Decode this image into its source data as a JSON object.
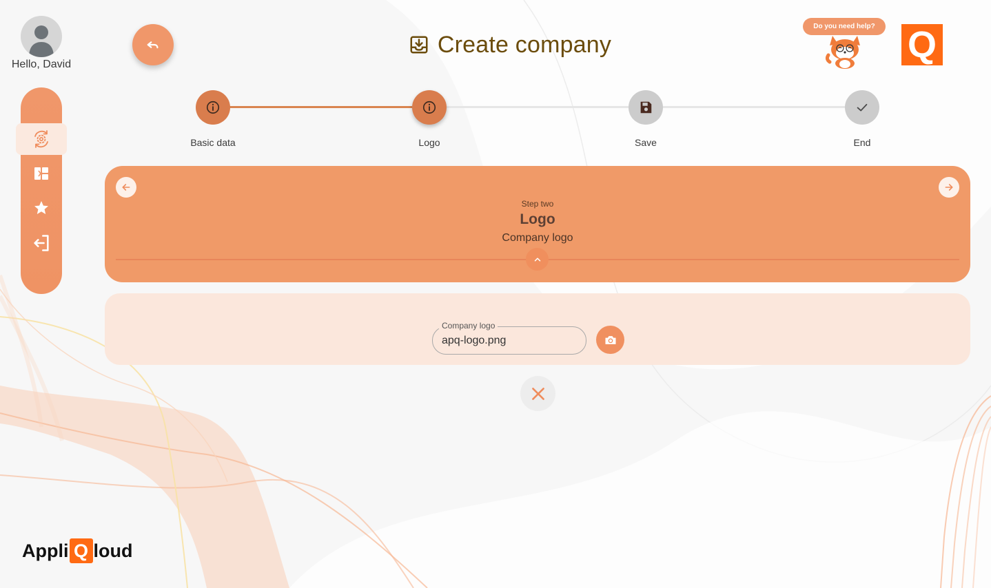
{
  "user": {
    "greeting": "Hello, David"
  },
  "header": {
    "title": "Create company",
    "title_icon": "download-box-icon",
    "help_text": "Do you need help?"
  },
  "stepper": {
    "steps": [
      {
        "label": "Basic data",
        "icon": "info-icon",
        "state": "completed"
      },
      {
        "label": "Logo",
        "icon": "info-icon",
        "state": "active"
      },
      {
        "label": "Save",
        "icon": "floppy-disk-icon",
        "state": "pending"
      },
      {
        "label": "End",
        "icon": "check-icon",
        "state": "pending"
      }
    ]
  },
  "step_card": {
    "overline": "Step two",
    "title": "Logo",
    "subtitle": "Company logo"
  },
  "form": {
    "logo_field": {
      "label": "Company logo",
      "value": "apq-logo.png"
    }
  },
  "sidebar": {
    "items": [
      {
        "icon": "settings-cycle-icon",
        "active": true
      },
      {
        "icon": "dashboard-blocks-icon",
        "active": false
      },
      {
        "icon": "star-icon",
        "active": false
      },
      {
        "icon": "logout-icon",
        "active": false
      }
    ]
  },
  "brand": {
    "left": "Appli",
    "q": "Q",
    "right": "loud",
    "corner_logo": "Q"
  },
  "colors": {
    "accent": "#f0976a",
    "accent_dark": "#d97d4d",
    "title": "#6b4c0c",
    "brand_orange": "#ff6a13",
    "content_bg": "#fbe7dc",
    "pending_step": "#cccccc"
  }
}
